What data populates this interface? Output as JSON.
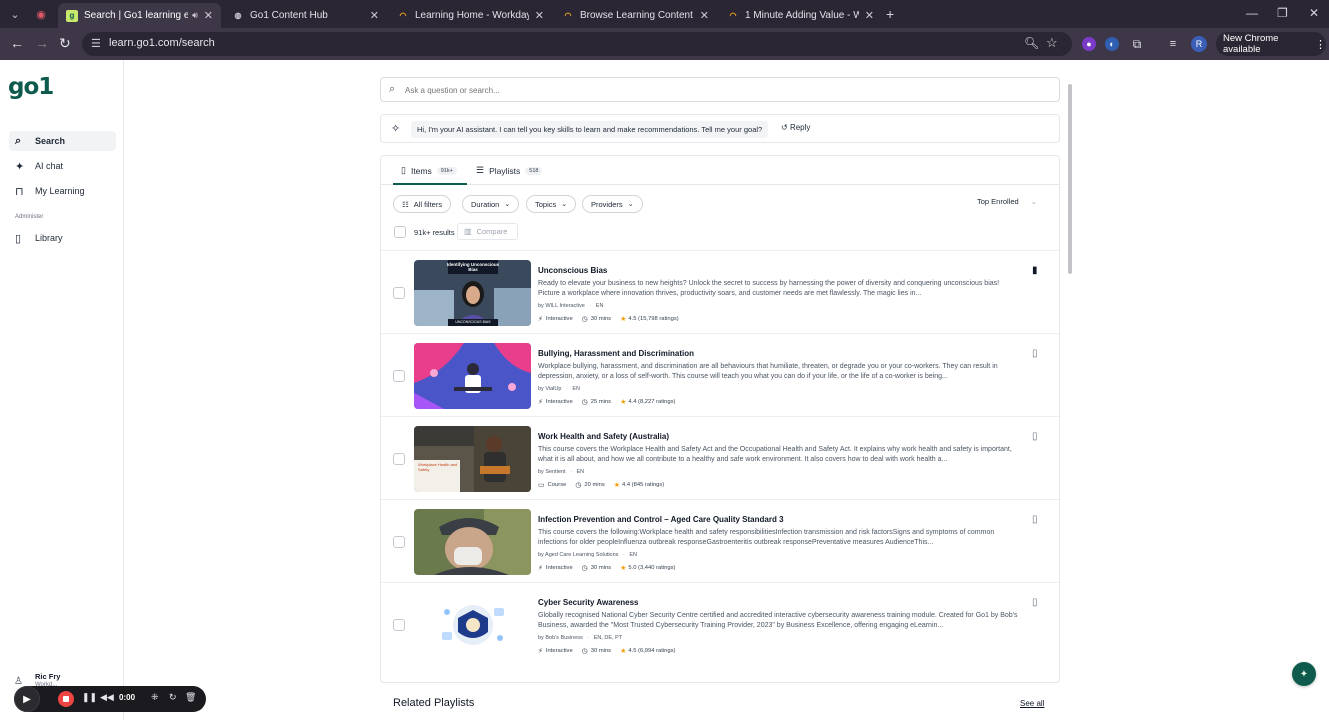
{
  "browser": {
    "tabs": [
      {
        "title": "Search | Go1 learning experi",
        "favicon": "go1-favicon",
        "active": true
      },
      {
        "title": "Go1 Content Hub",
        "favicon": "globe-favicon",
        "active": false
      },
      {
        "title": "Learning Home - Workday",
        "favicon": "workday-favicon",
        "active": false
      },
      {
        "title": "Browse Learning Content - Wor",
        "favicon": "workday-favicon",
        "active": false
      },
      {
        "title": "1 Minute Adding Value - Workd",
        "favicon": "workday-favicon",
        "active": false
      }
    ],
    "url": "learn.go1.com/search",
    "profile_initial": "R",
    "chrome_update": "New Chrome available"
  },
  "sidebar": {
    "logo": "go1",
    "items": [
      {
        "label": "Search",
        "icon": "search-icon",
        "active": true
      },
      {
        "label": "AI chat",
        "icon": "sparkle-icon",
        "active": false
      },
      {
        "label": "My Learning",
        "icon": "bookmark-icon",
        "active": false
      }
    ],
    "section_label": "Administer",
    "admin_items": [
      {
        "label": "Library",
        "icon": "book-icon"
      }
    ],
    "user": {
      "name": "Ric Fry",
      "subtitle": "Workd..."
    }
  },
  "search": {
    "placeholder": "Ask a question or search..."
  },
  "ai_assistant": {
    "message": "Hi, I'm your AI assistant. I can tell you key skills to learn and make recommendations. Tell me your goal?",
    "reply_label": "Reply"
  },
  "results": {
    "tabs": [
      {
        "label": "Items",
        "count": "91k+"
      },
      {
        "label": "Playlists",
        "count": "518"
      }
    ],
    "filters": {
      "all_filters": "All filters",
      "duration": "Duration",
      "topics": "Topics",
      "providers": "Providers"
    },
    "sort": "Top Enrolled",
    "result_count": "91k+ results",
    "compare_label": "Compare",
    "items": [
      {
        "title": "Unconscious Bias",
        "description": "Ready to elevate your business to new heights? Unlock the secret to success by harnessing the power of diversity and conquering unconscious bias! Picture a workplace where innovation thrives, productivity soars, and customer needs are met flawlessly. The magic lies in...",
        "provider": "by WILL Interactive",
        "language": "EN",
        "type": "Interactive",
        "duration": "30 mins",
        "rating": "4.5 (15,798 ratings)",
        "thumb_caption_top": "Identifying Unconscious Bias",
        "thumb_caption_bottom": "UNCONSCIOUS BIAS",
        "bookmarked": true
      },
      {
        "title": "Bullying, Harassment and Discrimination",
        "description": "Workplace bullying, harassment, and discrimination are all behaviours that humiliate, threaten, or degrade you or your co-workers. They can result in depression, anxiety, or a loss of self-worth. This course will teach you what you can do if your life, or the life of a co-worker is being...",
        "provider": "by VialUp",
        "language": "EN",
        "type": "Interactive",
        "duration": "25 mins",
        "rating": "4.4 (8,227 ratings)",
        "bookmarked": false
      },
      {
        "title": "Work Health and Safety (Australia)",
        "description": "This course covers the Workplace Health and Safety Act and the Occupational Health and Safety Act. It explains why work health and safety is important, what it is all about, and how we all contribute to a healthy and safe work environment. It also covers how to deal with work health a...",
        "provider": "by Sentient",
        "language": "EN",
        "type": "Course",
        "duration": "20 mins",
        "rating": "4.4 (845 ratings)",
        "thumb_caption": "Workplace Health and Safety",
        "bookmarked": false
      },
      {
        "title": "Infection Prevention and Control –  Aged Care Quality Standard 3",
        "description": "This course covers the following:Workplace health and safety responsibilitiesInfection transmission and risk factorsSigns and symptoms of common infections for older peopleInfluenza outbreak responseGastroenteritis outbreak responsePreventative measures AudienceThis...",
        "provider": "by Aged Care Learning Solutions",
        "language": "EN",
        "type": "Interactive",
        "duration": "30 mins",
        "rating": "5.0 (3,440 ratings)",
        "bookmarked": false
      },
      {
        "title": "Cyber Security Awareness",
        "description": "Globally recognised National Cyber Security Centre certified and accredited interactive cybersecurity awareness training module. Created for Go1 by Bob's Business, awarded the \"Most Trusted Cybersecurity Training Provider, 2023\" by Business Excellence, offering engaging eLearnin...",
        "provider": "by Bob's Business",
        "language": "EN, DE, PT",
        "type": "Interactive",
        "duration": "30 mins",
        "rating": "4.5 (6,994 ratings)",
        "bookmarked": false
      }
    ]
  },
  "related": {
    "title": "Related Playlists",
    "see_all": "See all"
  },
  "recorder": {
    "time": "0:00"
  },
  "colors": {
    "brand": "#0e5a4d",
    "star": "#f59e0b",
    "record": "#ef4444"
  }
}
